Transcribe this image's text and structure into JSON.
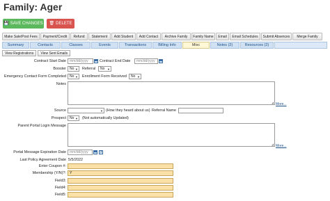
{
  "page": {
    "title": "Family: Ager"
  },
  "primary_buttons": {
    "save": "SAVE CHANGES",
    "delete": "DELETE"
  },
  "actions": [
    "Make Sale/Post Fees",
    "Payment/Credit",
    "Refund",
    "Statement",
    "Add Student",
    "Add Contact",
    "Archive Family",
    "Family Name",
    "Email",
    "Email Schedules",
    "Submit Absences",
    "Merge Family"
  ],
  "tabs": [
    "Summary",
    "Contacts",
    "Classes",
    "Events",
    "Transactions",
    "Billing Info",
    "Misc",
    "Notes (2)",
    "Resources (2)"
  ],
  "active_tab": "Misc",
  "subbuttons": {
    "view_registrations": "View Registrations",
    "view_sent_emails": "View Sent Emails"
  },
  "form": {
    "contract_start_label": "Contract Start Date",
    "contract_start_placeholder": "mm/dd/yyyy",
    "contract_end_label": "Contract End Date",
    "contract_end_placeholder": "mm/dd/yyyy",
    "booster_label": "Booster",
    "booster_value": "No",
    "referral_label": "Referral",
    "referral_value": "No",
    "ecf_label": "Emergency Contact Form Completed",
    "ecf_value": "No",
    "enrollment_label": "Enrollment Form Received",
    "enrollment_value": "No",
    "notes_label": "Notes",
    "more_link": "More...",
    "source_label": "Source",
    "source_hint": "(How they heard about us)",
    "referral_name_label": "Referral Name",
    "prospect_label": "Prospect",
    "prospect_value": "No",
    "prospect_hint": "(Not automatically Updated)",
    "portal_login_msg_label": "Parent Portal Login Message",
    "more_link_2": "More...",
    "portal_expiration_label": "Portal Message Expiration Date",
    "portal_expiration_placeholder": "mm/dd/yyyy",
    "last_policy_label": "Last Policy Agreement Date",
    "last_policy_value": "5/5/2022",
    "coupon_label": "Enter Coupon #:",
    "coupon_value": "",
    "membership_label": "Membership (Y/N)?:",
    "membership_value": "Y",
    "field3_label": "Field3:",
    "field4_label": "Field4:",
    "field5_label": "Field5:"
  },
  "colors": {
    "save": "#5cb85c",
    "delete": "#d9534f",
    "tab": "#cfe1f3",
    "active_tab": "#fff7d6",
    "custom_field": "#fbe0a8"
  }
}
